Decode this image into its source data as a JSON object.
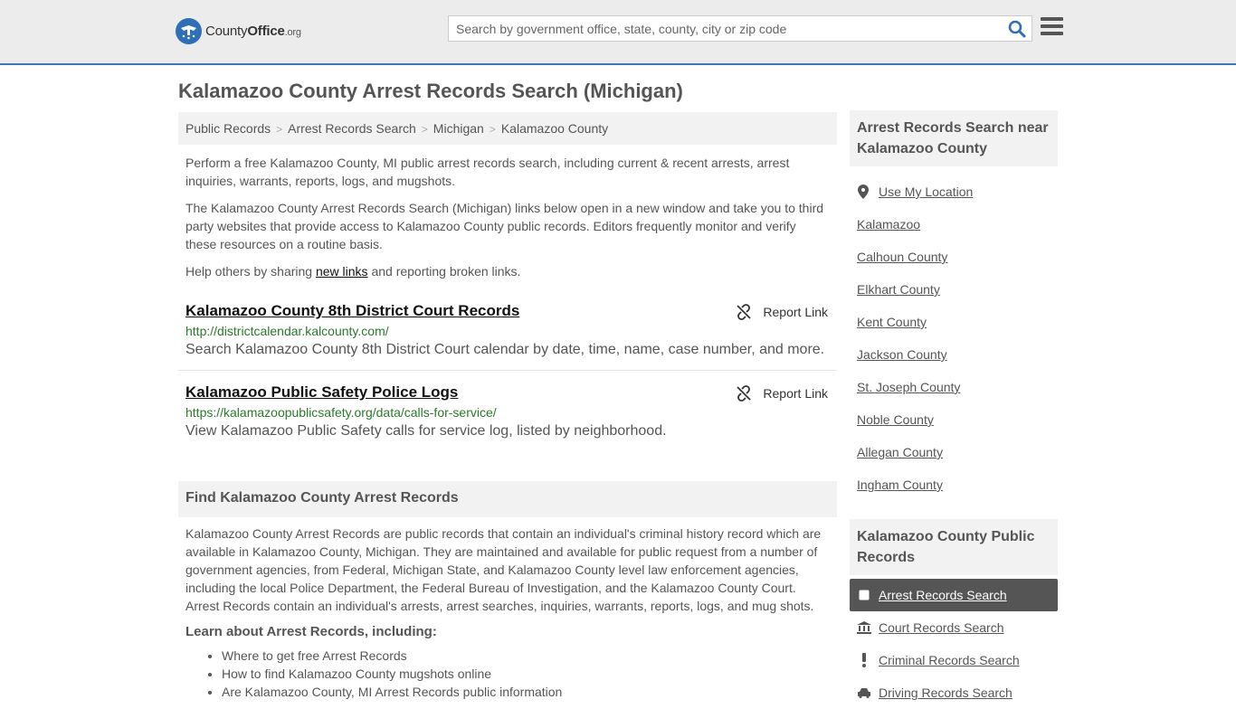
{
  "header": {
    "logo_county": "County",
    "logo_office": "Office",
    "logo_org": ".org",
    "search_placeholder": "Search by government office, state, county, city or zip code"
  },
  "page_title": "Kalamazoo County Arrest Records Search (Michigan)",
  "breadcrumb": [
    "Public Records",
    "Arrest Records Search",
    "Michigan",
    "Kalamazoo County"
  ],
  "intro": {
    "p1": "Perform a free Kalamazoo County, MI public arrest records search, including current & recent arrests, arrest inquiries, warrants, reports, logs, and mugshots.",
    "p2": "The Kalamazoo County Arrest Records Search (Michigan) links below open in a new window and take you to third party websites that provide access to Kalamazoo County public records. Editors frequently monitor and verify these resources on a routine basis.",
    "p3_before": "Help others by sharing ",
    "p3_link": "new links",
    "p3_after": " and reporting broken links."
  },
  "links": [
    {
      "title": "Kalamazoo County 8th District Court Records",
      "url": "http://districtcalendar.kalcounty.com/",
      "desc": "Search Kalamazoo County 8th District Court calendar by date, time, name, case number, and more.",
      "report": "Report Link"
    },
    {
      "title": "Kalamazoo Public Safety Police Logs",
      "url": "https://kalamazoopublicsafety.org/data/calls-for-service/",
      "desc": "View Kalamazoo Public Safety calls for service log, listed by neighborhood.",
      "report": "Report Link"
    }
  ],
  "find_section": {
    "heading": "Find Kalamazoo County Arrest Records",
    "body": "Kalamazoo County Arrest Records are public records that contain an individual's criminal history record which are available in Kalamazoo County, Michigan. They are maintained and available for public request from a number of government agencies, from Federal, Michigan State, and Kalamazoo County level law enforcement agencies, including the local Police Department, the Federal Bureau of Investigation, and the Kalamazoo County Court. Arrest Records contain an individual's arrests, arrest searches, inquiries, warrants, reports, logs, and mug shots.",
    "learn_heading": "Learn about Arrest Records, including:",
    "learn_items": [
      "Where to get free Arrest Records",
      "How to find Kalamazoo County mugshots online",
      "Are Kalamazoo County, MI Arrest Records public information"
    ]
  },
  "sidebar": {
    "near_heading": "Arrest Records Search near Kalamazoo County",
    "use_location": "Use My Location",
    "near_items": [
      "Kalamazoo",
      "Calhoun County",
      "Elkhart County",
      "Kent County",
      "Jackson County",
      "St. Joseph County",
      "Noble County",
      "Allegan County",
      "Ingham County"
    ],
    "public_heading": "Kalamazoo County Public Records",
    "public_items": [
      {
        "label": "Arrest Records Search",
        "icon": "square-icon",
        "active": true
      },
      {
        "label": "Court Records Search",
        "icon": "courthouse-icon",
        "active": false
      },
      {
        "label": "Criminal Records Search",
        "icon": "exclamation-icon",
        "active": false
      },
      {
        "label": "Driving Records Search",
        "icon": "car-icon",
        "active": false
      }
    ]
  },
  "colors": {
    "accent_blue": "#3a76b8",
    "url_green": "#2a7a2a",
    "active_bg": "#555555"
  }
}
